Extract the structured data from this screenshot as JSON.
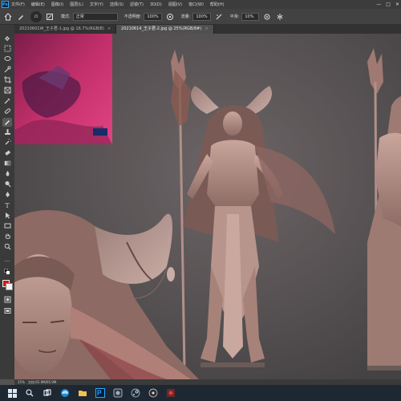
{
  "menubar": {
    "logo": "Ps",
    "items": [
      "文件(F)",
      "编辑(E)",
      "图像(I)",
      "图层(L)",
      "文字(Y)",
      "选择(S)",
      "滤镜(T)",
      "3D(D)",
      "视图(V)",
      "窗口(W)",
      "帮助(H)"
    ],
    "window_controls": [
      "—",
      "□",
      "✕"
    ]
  },
  "options": {
    "brush_size": "25",
    "mode_label": "模式:",
    "mode_value": "正常",
    "opacity_label": "不透明度:",
    "opacity_value": "100%",
    "flow_label": "流量:",
    "flow_value": "100%",
    "smoothing_label": "平滑:",
    "smoothing_value": "10%"
  },
  "tabs": [
    {
      "label": "20210601W_王子君-1.jpg @ 16.7%(RGB/8)",
      "close": "×"
    },
    {
      "label": "20210614_王子君-2.jpg @ 25%(RGB/8#)",
      "close": "×"
    }
  ],
  "status": {
    "zoom": "25%",
    "doc": "文档:65.9M/65.9M"
  },
  "colors": {
    "foreground": "#d01818",
    "background": "#f2f2f2"
  }
}
